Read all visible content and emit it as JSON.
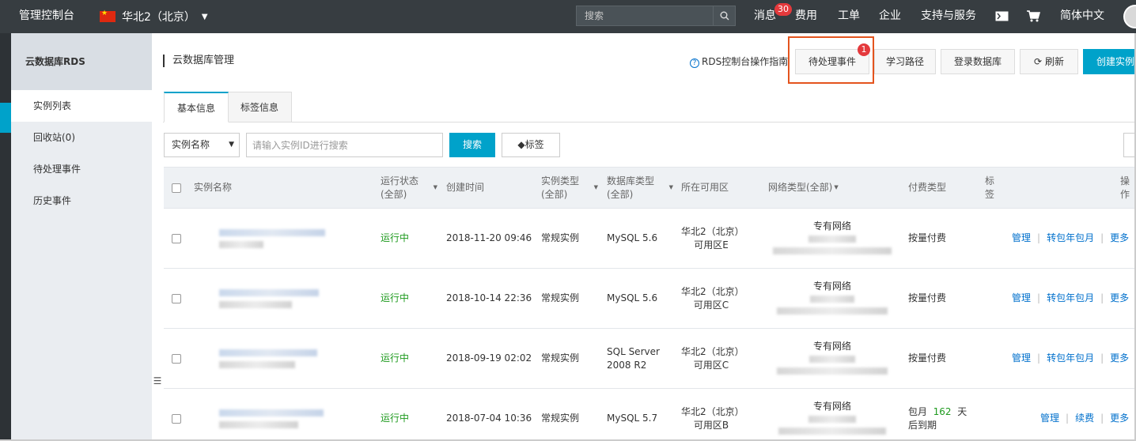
{
  "topbar": {
    "brand": "管理控制台",
    "region": "华北2（北京）",
    "search_placeholder": "搜索",
    "messages": "消息",
    "messages_badge": "30",
    "nav": [
      "费用",
      "工单",
      "企业",
      "支持与服务",
      "简体中文"
    ]
  },
  "sidebar": {
    "title": "云数据库RDS",
    "items": [
      {
        "label": "实例列表",
        "active": true
      },
      {
        "label": "回收站(0)",
        "active": false
      },
      {
        "label": "待处理事件",
        "active": false
      },
      {
        "label": "历史事件",
        "active": false
      }
    ]
  },
  "header": {
    "title": "云数据库管理",
    "help": "RDS控制台操作指南",
    "pending_events": "待处理事件",
    "pending_badge": "1",
    "learning_path": "学习路径",
    "login_db": "登录数据库",
    "refresh": "刷新",
    "create": "创建实例"
  },
  "tabs": [
    "基本信息",
    "标签信息"
  ],
  "filter": {
    "field": "实例名称",
    "placeholder": "请输入实例ID进行搜索",
    "search": "搜索",
    "tag": "标签"
  },
  "table": {
    "headers": {
      "name": "实例名称",
      "status": "运行状态(全部)",
      "created": "创建时间",
      "inst_type": "实例类型(全部)",
      "db_type": "数据库类型(全部)",
      "zone": "所在可用区",
      "network": "网络类型(全部)",
      "billing": "付费类型",
      "tags": "标签",
      "ops": "操作"
    },
    "rows": [
      {
        "status": "运行中",
        "created": "2018-11-20 09:46",
        "inst_type": "常规实例",
        "db_l1": "MySQL 5.6",
        "db_l2": "",
        "zone_l1": "华北2（北京）",
        "zone_l2": "可用区E",
        "network": "专有网络",
        "billing": "按量付费",
        "ops": [
          "管理",
          "转包年包月",
          "更多"
        ]
      },
      {
        "status": "运行中",
        "created": "2018-10-14 22:36",
        "inst_type": "常规实例",
        "db_l1": "MySQL 5.6",
        "db_l2": "",
        "zone_l1": "华北2（北京）",
        "zone_l2": "可用区C",
        "network": "专有网络",
        "billing": "按量付费",
        "ops": [
          "管理",
          "转包年包月",
          "更多"
        ]
      },
      {
        "status": "运行中",
        "created": "2018-09-19 02:02",
        "inst_type": "常规实例",
        "db_l1": "SQL Server",
        "db_l2": "2008 R2",
        "zone_l1": "华北2（北京）",
        "zone_l2": "可用区C",
        "network": "专有网络",
        "billing": "按量付费",
        "ops": [
          "管理",
          "转包年包月",
          "更多"
        ]
      },
      {
        "status": "运行中",
        "created": "2018-07-04 10:36",
        "inst_type": "常规实例",
        "db_l1": "MySQL 5.7",
        "db_l2": "",
        "zone_l1": "华北2（北京）",
        "zone_l2": "可用区B",
        "network": "专有网络",
        "billing_l1": "包月",
        "billing_days": "162",
        "billing_unit": "天",
        "billing_l2": "后到期",
        "ops": [
          "管理",
          "续费",
          "更多"
        ]
      }
    ]
  }
}
